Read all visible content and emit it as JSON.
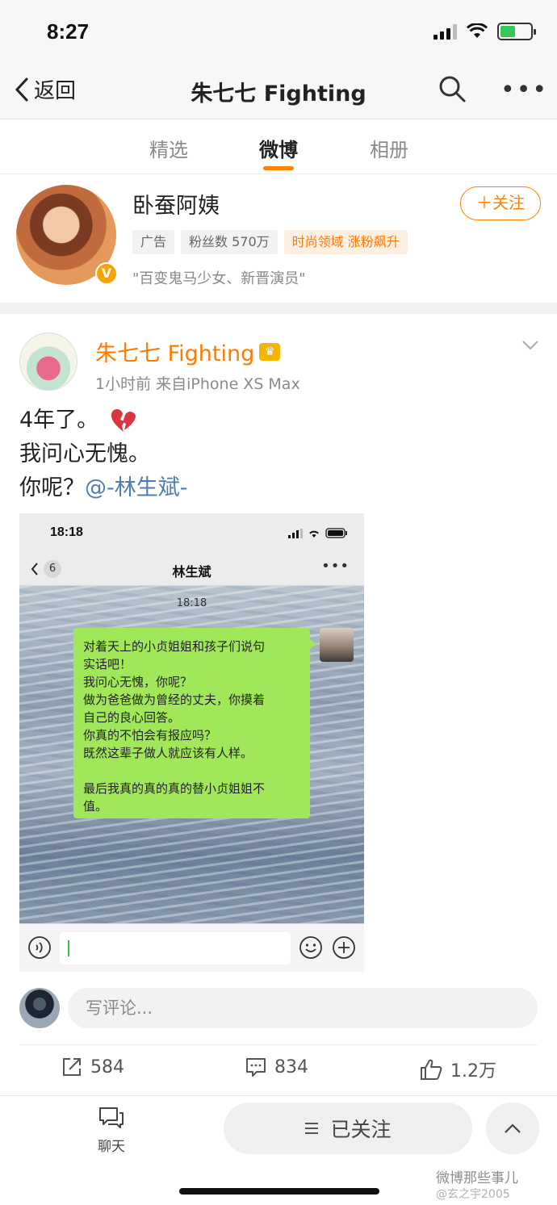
{
  "status_bar": {
    "time": "8:27"
  },
  "nav": {
    "back_label": "返回",
    "title": "朱七七 Fighting"
  },
  "tabs": [
    {
      "label": "精选"
    },
    {
      "label": "微博",
      "active": true
    },
    {
      "label": "相册"
    }
  ],
  "ad": {
    "name": "卧蚕阿姨",
    "follow_label": "＋关注",
    "verified_badge": "V",
    "tags": [
      "广告",
      "粉丝数 570万",
      "时尚领域 涨粉飙升"
    ],
    "description": "\"百变鬼马少女、新晋演员\""
  },
  "post": {
    "author": "朱七七 Fighting",
    "vip_icon": "crown-icon",
    "meta": "1小时前  来自iPhone XS Max",
    "lines": [
      "4年了。",
      "我问心无愧。",
      "你呢？"
    ],
    "mention": "@-林生斌-",
    "emoji": "broken-heart-icon"
  },
  "screenshot": {
    "time": "18:18",
    "unread_count": "6",
    "title": "林生斌",
    "timestamp": "18:18",
    "message_lines": [
      "对着天上的小贞姐姐和孩子们说句",
      "实话吧！",
      "我问心无愧，你呢？",
      "做为爸爸做为曾经的丈夫，你摸着",
      "自己的良心回答。",
      "你真的不怕会有报应吗？",
      "既然这辈子做人就应该有人样。",
      "",
      "最后我真的真的真的替小贞姐姐不",
      "值。"
    ]
  },
  "comment": {
    "placeholder": "写评论..."
  },
  "actions": {
    "repost": "584",
    "comments": "834",
    "likes": "1.2万"
  },
  "bottom": {
    "chat_label": "聊天",
    "followed_label": "已关注"
  },
  "watermark": {
    "line1": "微博那些事儿",
    "line2": "@玄之宇2005"
  },
  "colors": {
    "accent": "#ff8200",
    "mention": "#507daf",
    "bubble": "#a0e75a"
  }
}
